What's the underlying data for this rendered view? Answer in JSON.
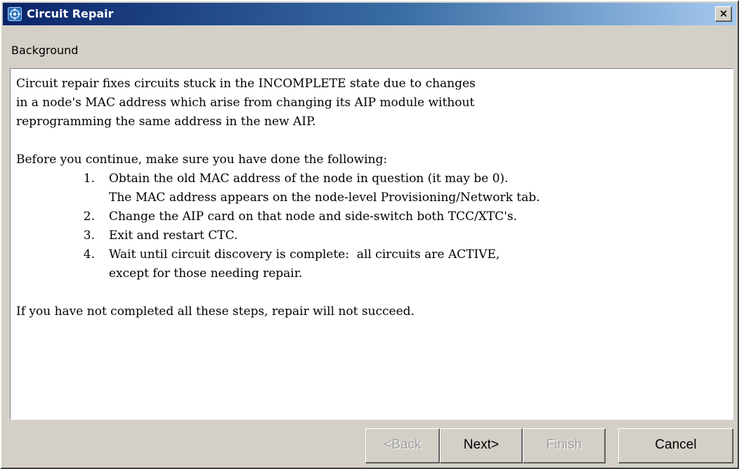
{
  "window": {
    "title": "Circuit Repair",
    "title_icon": "circuit-repair-icon",
    "close_label": "×"
  },
  "section": {
    "label": "Background"
  },
  "content": {
    "intro_lines": [
      "Circuit repair fixes circuits stuck in the INCOMPLETE state due to changes",
      "in a node's MAC address which arise from changing its AIP module without",
      "reprogramming the same address in the new AIP."
    ],
    "lead_in": "Before you continue, make sure you have done the following:",
    "steps": [
      {
        "num": "1.",
        "lines": [
          "Obtain the old MAC address of the node in question (it may be 0).",
          "The MAC address appears on the node-level Provisioning/Network tab."
        ]
      },
      {
        "num": "2.",
        "lines": [
          "Change the AIP card on that node and side-switch both TCC/XTC's."
        ]
      },
      {
        "num": "3.",
        "lines": [
          "Exit and restart CTC."
        ]
      },
      {
        "num": "4.",
        "lines": [
          "Wait until circuit discovery is complete:  all circuits are ACTIVE,",
          "except for those needing repair."
        ]
      }
    ],
    "warning": "If you have not completed all these steps, repair will not succeed."
  },
  "buttons": {
    "back": {
      "label": "<Back",
      "enabled": false
    },
    "next": {
      "label": "Next>",
      "enabled": true
    },
    "finish": {
      "label": "Finish",
      "enabled": false
    },
    "cancel": {
      "label": "Cancel",
      "enabled": true
    }
  }
}
